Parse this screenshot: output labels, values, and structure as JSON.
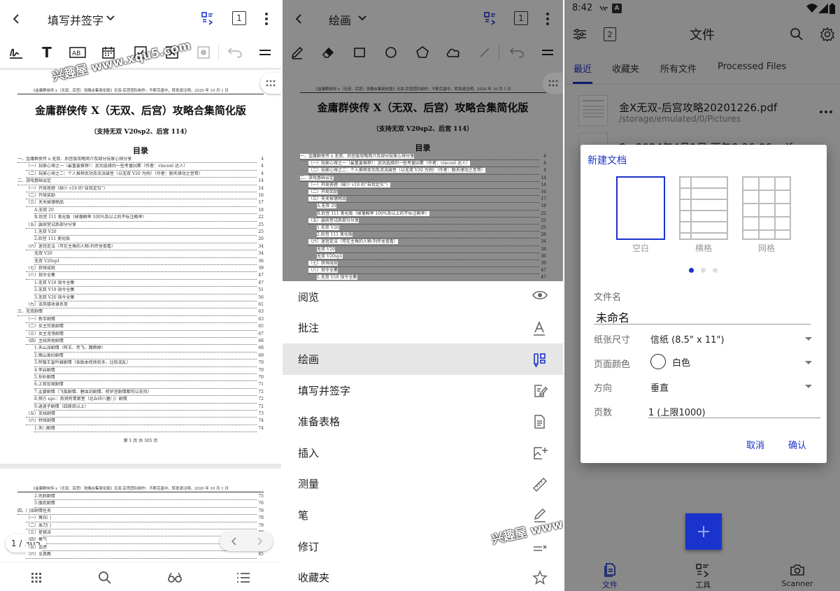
{
  "panel1": {
    "title": "填写并签字",
    "page_btn": "1",
    "watermark": "兴趣屋 www.xqu5.com",
    "doc": {
      "header_line": "《金庸群侠传 x（无双、后宫）攻略合集简化版》无双-后宫团队制作，不断完善中，转发请注明。2020 年 10 月 1 日",
      "title": "金庸群侠传 X（无双、后宫）攻略合集简化版",
      "subtitle": "（支持无双 V20sp2、后宫 114）",
      "toc_title": "目录",
      "toc": [
        {
          "t": "一、金庸群侠传 x 无双、后宫版攻略简介及部分玩家心得分享",
          "n": "4",
          "i": 0
        },
        {
          "t": "（一）玩家心得之一（最重要推荐）：武功选择的一些考量因素（作者：vincent 达人）",
          "n": "4",
          "i": 1
        },
        {
          "t": "（二）玩家心得之二：个人推荐武功及流派属性（以无双 V20 为例）（作者：颤天律动之音哥）",
          "n": "4",
          "i": 1
        },
        {
          "t": "二、游戏基础设定",
          "n": "14",
          "i": 0
        },
        {
          "t": "（一）开局答题（缺少 v19 的“自我定位”）",
          "n": "14",
          "i": 1
        },
        {
          "t": "（二）开局奖励",
          "n": "16",
          "i": 1
        },
        {
          "t": "（三）天关掉落物品",
          "n": "17",
          "i": 1
        },
        {
          "t": "A.无双 20",
          "n": "18",
          "i": 2
        },
        {
          "t": "B.后宫 111 美化版（掉落概率 100%及以上的不标注概率）",
          "n": "22",
          "i": 2
        },
        {
          "t": "（五）霹雳堂试炼部分分享",
          "n": "25",
          "i": 1
        },
        {
          "t": "1.无双 V20",
          "n": "25",
          "i": 2
        },
        {
          "t": "2.后宫 111 美化版",
          "n": "26",
          "i": 2
        },
        {
          "t": "（六）迷宫走法（可在主角的人物-列传里查看）",
          "n": "34",
          "i": 1
        },
        {
          "t": "无双 V20",
          "n": "34",
          "i": 2
        },
        {
          "t": "无双 V20sp1",
          "n": "36",
          "i": 2
        },
        {
          "t": "（七）获得成就",
          "n": "39",
          "i": 1
        },
        {
          "t": "（八）指令全集",
          "n": "47",
          "i": 1
        },
        {
          "t": "1.无双 V18 指令全集",
          "n": "47",
          "i": 2
        },
        {
          "t": "2.无双 V19 指令全集",
          "n": "51",
          "i": 2
        },
        {
          "t": "3.无双 V20 指令全集",
          "n": "56",
          "i": 2
        },
        {
          "t": "（九）流风楼收录名单",
          "n": "61",
          "i": 1
        },
        {
          "t": "三、无双剧情",
          "n": "63",
          "i": 0
        },
        {
          "t": "（一）新手剧情",
          "n": "63",
          "i": 1
        },
        {
          "t": "（二）女主完美剧情",
          "n": "65",
          "i": 1
        },
        {
          "t": "（三）女主淫荡剧情",
          "n": "67",
          "i": 1
        },
        {
          "t": "（四）主线其他剧情",
          "n": "68",
          "i": 1
        },
        {
          "t": "1.天山派剧情（阿玉、贾飞、魏雨婷）",
          "n": "68",
          "i": 2
        },
        {
          "t": "2.佛山美妇剧情",
          "n": "69",
          "i": 2
        },
        {
          "t": "3.阿樱王雷吟雅剧情（各版本修改较多，比较混乱）",
          "n": "70",
          "i": 2
        },
        {
          "t": "4.李启剧情",
          "n": "70",
          "i": 2
        },
        {
          "t": "5.东砂剧情",
          "n": "70",
          "i": 2
        },
        {
          "t": "6.上官宏斌剧情",
          "n": "71",
          "i": 2
        },
        {
          "t": "7.孟婆剧情（飞狐剧情、碧血剑剧情、修罗宫剧情都可以支持）",
          "n": "72",
          "i": 2
        },
        {
          "t": "8.预方 npc：南贤阿青紫萱（北丘印八塞门）剧情",
          "n": "72",
          "i": 2
        },
        {
          "t": "9.逍遥子剧情（四周目以上）",
          "n": "72",
          "i": 2
        },
        {
          "t": "（五）支线剧情",
          "n": "73",
          "i": 1
        },
        {
          "t": "（六）特殊剧情",
          "n": "74",
          "i": 1
        },
        {
          "t": "1.天门剧情",
          "n": "74",
          "i": 2
        }
      ],
      "footer": "第 1 页 共 305 页",
      "p2_toc": [
        {
          "t": "2.凭跃剧情",
          "n": "75",
          "i": 2
        },
        {
          "t": "3.搜武剧情",
          "n": "76",
          "i": 2
        },
        {
          "t": "四、门派剧情任务",
          "n": "78",
          "i": 0
        },
        {
          "t": "（一）寓衣门",
          "n": "78",
          "i": 1
        },
        {
          "t": "（二）血刀门",
          "n": "79",
          "i": 1
        },
        {
          "t": "（三）星宿派",
          "n": "80",
          "i": 1
        },
        {
          "t": "（四）聚气",
          "n": "81",
          "i": 1
        },
        {
          "t": "（五）金虎",
          "n": "83",
          "i": 1
        },
        {
          "t": "（六）全真教",
          "n": "85",
          "i": 1
        }
      ]
    },
    "page_indicator": "1 / 305"
  },
  "panel2": {
    "title": "绘画",
    "page_btn": "1",
    "watermark": "兴趣屋 www.xqu5.com",
    "menu": [
      {
        "label": "阅览",
        "icon": "eye-icon"
      },
      {
        "label": "批注",
        "icon": "text-underline-icon"
      },
      {
        "label": "绘画",
        "icon": "pens-icon",
        "active": true
      },
      {
        "label": "填写并签字",
        "icon": "fill-sign-icon"
      },
      {
        "label": "准备表格",
        "icon": "form-icon"
      },
      {
        "label": "插入",
        "icon": "insert-image-icon"
      },
      {
        "label": "测量",
        "icon": "ruler-icon"
      },
      {
        "label": "笔",
        "icon": "pen-icon"
      },
      {
        "label": "修订",
        "icon": "redact-icon"
      },
      {
        "label": "收藏夹",
        "icon": "star-icon"
      }
    ]
  },
  "panel3": {
    "status": {
      "time": "8:42"
    },
    "title": "文件",
    "tabs": [
      "最近",
      "收藏夹",
      "所有文件",
      "Processed Files"
    ],
    "file": {
      "name": "金X无双-后宫攻略20201226.pdf",
      "path": "/storage/emulated/0/Pictures"
    },
    "file2_partial": "S...2024年4月1日 下午8:36:06.pdf",
    "dialog": {
      "title": "新建文档",
      "templates": [
        "空白",
        "横格",
        "网格"
      ],
      "filename_label": "文件名",
      "filename_value": "未命名",
      "paper_label": "纸张尺寸",
      "paper_value": "信纸 (8.5\" x 11\")",
      "color_label": "页面颜色",
      "color_value": "白色",
      "orient_label": "方向",
      "orient_value": "垂直",
      "pages_label": "页数",
      "pages_value": "1 (上限1000)",
      "cancel": "取消",
      "ok": "确认"
    },
    "bottom_nav": [
      "文件",
      "工具",
      "Scanner"
    ],
    "accent": "#1a33cc"
  }
}
